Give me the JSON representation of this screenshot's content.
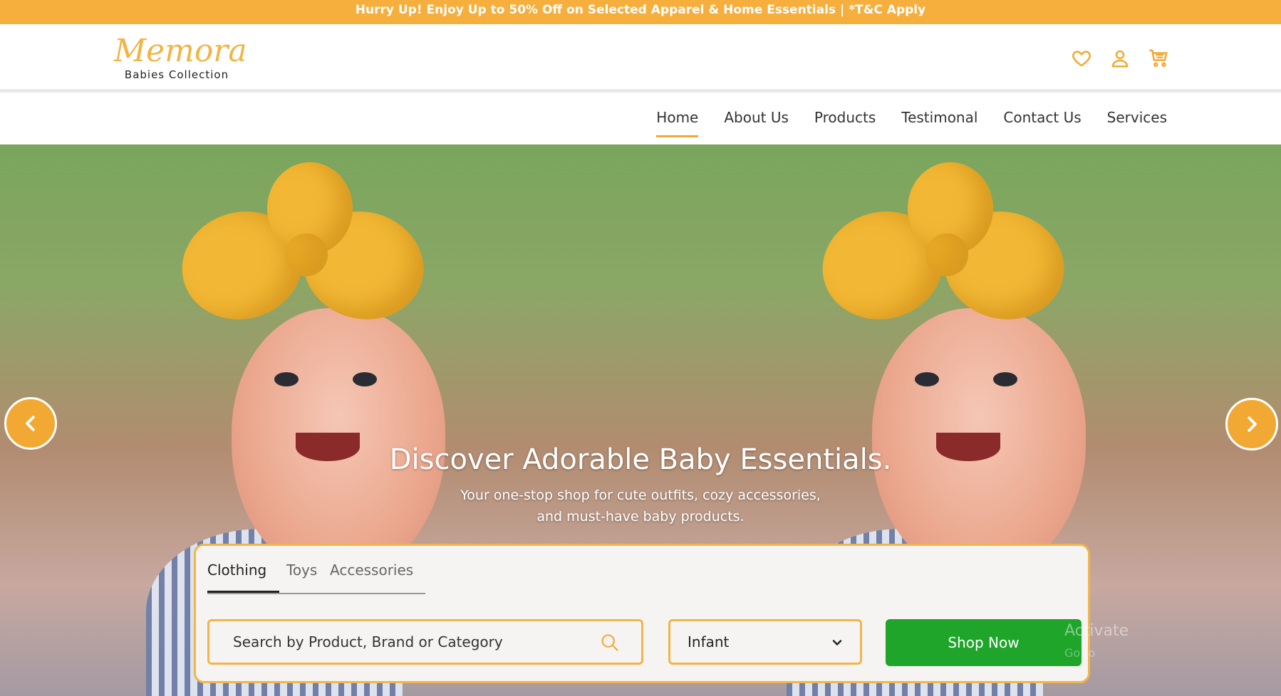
{
  "promo": {
    "text": "Hurry Up! Enjoy Up to 50% Off on Selected Apparel & Home Essentials | *T&C Apply"
  },
  "brand": {
    "name": "Memora",
    "tagline": "Babies Collection",
    "accent": "#f0b545"
  },
  "header": {
    "icons": [
      "heart-icon",
      "user-icon",
      "cart-icon"
    ]
  },
  "nav": {
    "items": [
      {
        "label": "Home",
        "active": true
      },
      {
        "label": "About Us"
      },
      {
        "label": "Products"
      },
      {
        "label": "Testimonal"
      },
      {
        "label": "Contact Us"
      },
      {
        "label": "Services"
      }
    ]
  },
  "hero": {
    "title": "Discover Adorable Baby Essentials.",
    "subtitle_line1": "Your one-stop shop for cute outfits, cozy accessories,",
    "subtitle_line2": "and must-have baby products."
  },
  "search": {
    "tabs": [
      {
        "label": "Clothing",
        "active": true
      },
      {
        "label": "Toys"
      },
      {
        "label": "Accessories"
      }
    ],
    "placeholder": "Search by Product, Brand or Category",
    "age_select": "Infant",
    "button_label": "Shop Now"
  },
  "colors": {
    "promo_bg": "#f6ae3c",
    "accent": "#f2a933",
    "cta_green": "#1ea52a"
  },
  "watermark": {
    "line1": "Activate",
    "line2": "Go to"
  }
}
